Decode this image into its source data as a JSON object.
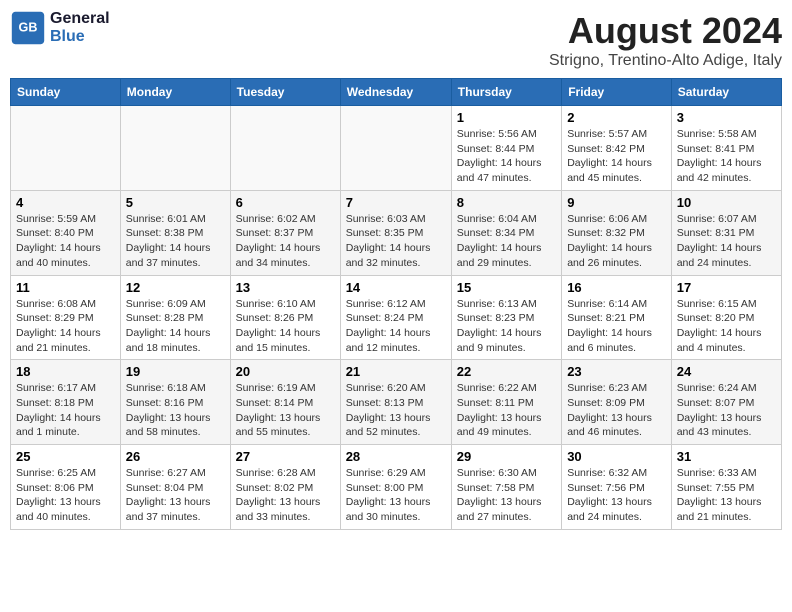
{
  "logo": {
    "line1": "General",
    "line2": "Blue"
  },
  "title": "August 2024",
  "subtitle": "Strigno, Trentino-Alto Adige, Italy",
  "days_of_week": [
    "Sunday",
    "Monday",
    "Tuesday",
    "Wednesday",
    "Thursday",
    "Friday",
    "Saturday"
  ],
  "weeks": [
    [
      {
        "day": "",
        "info": ""
      },
      {
        "day": "",
        "info": ""
      },
      {
        "day": "",
        "info": ""
      },
      {
        "day": "",
        "info": ""
      },
      {
        "day": "1",
        "info": "Sunrise: 5:56 AM\nSunset: 8:44 PM\nDaylight: 14 hours and 47 minutes."
      },
      {
        "day": "2",
        "info": "Sunrise: 5:57 AM\nSunset: 8:42 PM\nDaylight: 14 hours and 45 minutes."
      },
      {
        "day": "3",
        "info": "Sunrise: 5:58 AM\nSunset: 8:41 PM\nDaylight: 14 hours and 42 minutes."
      }
    ],
    [
      {
        "day": "4",
        "info": "Sunrise: 5:59 AM\nSunset: 8:40 PM\nDaylight: 14 hours and 40 minutes."
      },
      {
        "day": "5",
        "info": "Sunrise: 6:01 AM\nSunset: 8:38 PM\nDaylight: 14 hours and 37 minutes."
      },
      {
        "day": "6",
        "info": "Sunrise: 6:02 AM\nSunset: 8:37 PM\nDaylight: 14 hours and 34 minutes."
      },
      {
        "day": "7",
        "info": "Sunrise: 6:03 AM\nSunset: 8:35 PM\nDaylight: 14 hours and 32 minutes."
      },
      {
        "day": "8",
        "info": "Sunrise: 6:04 AM\nSunset: 8:34 PM\nDaylight: 14 hours and 29 minutes."
      },
      {
        "day": "9",
        "info": "Sunrise: 6:06 AM\nSunset: 8:32 PM\nDaylight: 14 hours and 26 minutes."
      },
      {
        "day": "10",
        "info": "Sunrise: 6:07 AM\nSunset: 8:31 PM\nDaylight: 14 hours and 24 minutes."
      }
    ],
    [
      {
        "day": "11",
        "info": "Sunrise: 6:08 AM\nSunset: 8:29 PM\nDaylight: 14 hours and 21 minutes."
      },
      {
        "day": "12",
        "info": "Sunrise: 6:09 AM\nSunset: 8:28 PM\nDaylight: 14 hours and 18 minutes."
      },
      {
        "day": "13",
        "info": "Sunrise: 6:10 AM\nSunset: 8:26 PM\nDaylight: 14 hours and 15 minutes."
      },
      {
        "day": "14",
        "info": "Sunrise: 6:12 AM\nSunset: 8:24 PM\nDaylight: 14 hours and 12 minutes."
      },
      {
        "day": "15",
        "info": "Sunrise: 6:13 AM\nSunset: 8:23 PM\nDaylight: 14 hours and 9 minutes."
      },
      {
        "day": "16",
        "info": "Sunrise: 6:14 AM\nSunset: 8:21 PM\nDaylight: 14 hours and 6 minutes."
      },
      {
        "day": "17",
        "info": "Sunrise: 6:15 AM\nSunset: 8:20 PM\nDaylight: 14 hours and 4 minutes."
      }
    ],
    [
      {
        "day": "18",
        "info": "Sunrise: 6:17 AM\nSunset: 8:18 PM\nDaylight: 14 hours and 1 minute."
      },
      {
        "day": "19",
        "info": "Sunrise: 6:18 AM\nSunset: 8:16 PM\nDaylight: 13 hours and 58 minutes."
      },
      {
        "day": "20",
        "info": "Sunrise: 6:19 AM\nSunset: 8:14 PM\nDaylight: 13 hours and 55 minutes."
      },
      {
        "day": "21",
        "info": "Sunrise: 6:20 AM\nSunset: 8:13 PM\nDaylight: 13 hours and 52 minutes."
      },
      {
        "day": "22",
        "info": "Sunrise: 6:22 AM\nSunset: 8:11 PM\nDaylight: 13 hours and 49 minutes."
      },
      {
        "day": "23",
        "info": "Sunrise: 6:23 AM\nSunset: 8:09 PM\nDaylight: 13 hours and 46 minutes."
      },
      {
        "day": "24",
        "info": "Sunrise: 6:24 AM\nSunset: 8:07 PM\nDaylight: 13 hours and 43 minutes."
      }
    ],
    [
      {
        "day": "25",
        "info": "Sunrise: 6:25 AM\nSunset: 8:06 PM\nDaylight: 13 hours and 40 minutes."
      },
      {
        "day": "26",
        "info": "Sunrise: 6:27 AM\nSunset: 8:04 PM\nDaylight: 13 hours and 37 minutes."
      },
      {
        "day": "27",
        "info": "Sunrise: 6:28 AM\nSunset: 8:02 PM\nDaylight: 13 hours and 33 minutes."
      },
      {
        "day": "28",
        "info": "Sunrise: 6:29 AM\nSunset: 8:00 PM\nDaylight: 13 hours and 30 minutes."
      },
      {
        "day": "29",
        "info": "Sunrise: 6:30 AM\nSunset: 7:58 PM\nDaylight: 13 hours and 27 minutes."
      },
      {
        "day": "30",
        "info": "Sunrise: 6:32 AM\nSunset: 7:56 PM\nDaylight: 13 hours and 24 minutes."
      },
      {
        "day": "31",
        "info": "Sunrise: 6:33 AM\nSunset: 7:55 PM\nDaylight: 13 hours and 21 minutes."
      }
    ]
  ]
}
